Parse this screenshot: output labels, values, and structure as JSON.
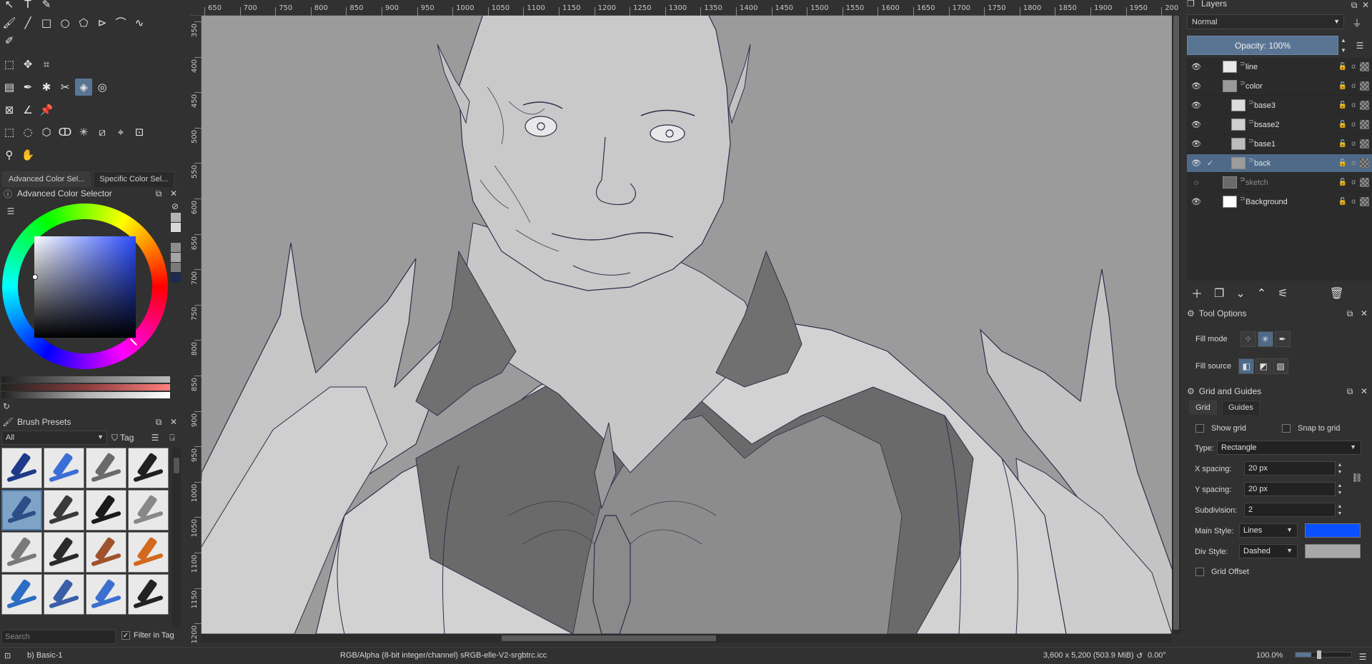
{
  "toolbox": {
    "tools": [
      {
        "name": "select-shapes-tool",
        "glyph": "↖"
      },
      {
        "name": "text-tool",
        "glyph": "T"
      },
      {
        "name": "edit-shapes-tool",
        "glyph": "✎"
      },
      {
        "name": "freehand-brush-tool",
        "glyph": "🖌"
      },
      {
        "name": "line-tool",
        "glyph": "╱"
      },
      {
        "name": "rectangle-tool",
        "glyph": "□"
      },
      {
        "name": "ellipse-tool",
        "glyph": "○"
      },
      {
        "name": "polygon-tool",
        "glyph": "⬠"
      },
      {
        "name": "polyline-tool",
        "glyph": "⊳"
      },
      {
        "name": "bezier-curve-tool",
        "glyph": "⌒"
      },
      {
        "name": "freehand-path-tool",
        "glyph": "∿"
      },
      {
        "name": "dynamic-brush-tool",
        "glyph": "✐"
      },
      {
        "name": "transform-tool",
        "glyph": "⬚"
      },
      {
        "name": "move-tool",
        "glyph": "✥"
      },
      {
        "name": "crop-tool",
        "glyph": "⌗"
      },
      {
        "name": "gradient-tool",
        "glyph": "▤"
      },
      {
        "name": "color-picker-tool",
        "glyph": "✒"
      },
      {
        "name": "colorize-mask-tool",
        "glyph": "✱"
      },
      {
        "name": "smart-patch-tool",
        "glyph": "✂"
      },
      {
        "name": "fill-tool",
        "glyph": "◈"
      },
      {
        "name": "enclose-fill-tool",
        "glyph": "◎"
      },
      {
        "name": "assistant-tool",
        "glyph": "⊠"
      },
      {
        "name": "measure-tool",
        "glyph": "∠"
      },
      {
        "name": "reference-images-tool",
        "glyph": "📌"
      },
      {
        "name": "rectangular-selection-tool",
        "glyph": "⬚"
      },
      {
        "name": "elliptical-selection-tool",
        "glyph": "◌"
      },
      {
        "name": "polygonal-selection-tool",
        "glyph": "⬡"
      },
      {
        "name": "freehand-selection-tool",
        "glyph": "ↀ"
      },
      {
        "name": "contiguous-selection-tool",
        "glyph": "✳"
      },
      {
        "name": "similar-selection-tool",
        "glyph": "⧄"
      },
      {
        "name": "bezier-selection-tool",
        "glyph": "⌖"
      },
      {
        "name": "magnetic-selection-tool",
        "glyph": "⊡"
      },
      {
        "name": "zoom-tool",
        "glyph": "⚲"
      },
      {
        "name": "pan-tool",
        "glyph": "✋"
      }
    ],
    "dock_tabs": [
      "Advanced Color Sel...",
      "Specific Color Sel..."
    ],
    "color_selector_title": "Advanced Color Selector",
    "swatches": [
      "#b3b3b3",
      "#d9d9d9",
      "#313131",
      "#8c8c8c",
      "#a6a6a6",
      "#7a7a7a",
      "#1c2a52"
    ],
    "brush_presets_title": "Brush Presets",
    "brush_filter": "All",
    "tag_label": "Tag",
    "brushes": [
      {
        "name": "brush-eraser-soft",
        "tip": "#1f3a8a"
      },
      {
        "name": "brush-eraser-hard",
        "tip": "#3c6fd6"
      },
      {
        "name": "brush-blender",
        "tip": "#6a6a6a"
      },
      {
        "name": "brush-ink-pen",
        "tip": "#202020"
      },
      {
        "name": "brush-basic-1",
        "tip": "#2b4e86"
      },
      {
        "name": "brush-basic-2",
        "tip": "#3a3a3a"
      },
      {
        "name": "brush-marker",
        "tip": "#1a1a1a"
      },
      {
        "name": "brush-airbrush",
        "tip": "#888888"
      },
      {
        "name": "brush-pencil-soft",
        "tip": "#7a7a7a"
      },
      {
        "name": "brush-ink-brush",
        "tip": "#2a2a2a"
      },
      {
        "name": "brush-paint-brush",
        "tip": "#a0522d"
      },
      {
        "name": "brush-dry-brush",
        "tip": "#d2691e"
      },
      {
        "name": "brush-pencil-blue",
        "tip": "#2b6cc4"
      },
      {
        "name": "brush-pencil-hb",
        "tip": "#3a5ea8"
      },
      {
        "name": "brush-pencil-light",
        "tip": "#3b6fd0"
      },
      {
        "name": "brush-pencil-dark",
        "tip": "#222222"
      }
    ],
    "search_placeholder": "Search",
    "filter_in_tag_label": "Filter in Tag"
  },
  "canvas": {
    "ruler_h": [
      "650",
      "700",
      "750",
      "800",
      "850",
      "900",
      "950",
      "1000",
      "1050",
      "1100",
      "1150",
      "1200",
      "1250",
      "1300",
      "1350",
      "1400",
      "1450",
      "1500",
      "1550",
      "1600",
      "1650",
      "1700",
      "1750",
      "1800",
      "1850",
      "1900",
      "1950",
      "200"
    ],
    "ruler_v": [
      "350",
      "400",
      "450",
      "500",
      "550",
      "600",
      "650",
      "700",
      "750",
      "800",
      "850",
      "900",
      "950",
      "1000",
      "1050",
      "1100",
      "1150",
      "1200"
    ]
  },
  "layers": {
    "title": "Layers",
    "blend_mode": "Normal",
    "opacity_label": "Opacity:  100%",
    "items": [
      {
        "name": "line",
        "visible": true,
        "thumb": "#e8e8e8",
        "indent": 0,
        "selected": false
      },
      {
        "name": "color",
        "visible": true,
        "thumb": "#9a9a9a",
        "indent": 0,
        "selected": false
      },
      {
        "name": "base3",
        "visible": true,
        "thumb": "#dcdcdc",
        "indent": 1,
        "selected": false
      },
      {
        "name": "bsase2",
        "visible": true,
        "thumb": "#cfcfcf",
        "indent": 1,
        "selected": false
      },
      {
        "name": "base1",
        "visible": true,
        "thumb": "#bcbcbc",
        "indent": 1,
        "selected": false
      },
      {
        "name": "back",
        "visible": true,
        "thumb": "#9c9c9c",
        "indent": 1,
        "selected": true
      },
      {
        "name": "sketch",
        "visible": false,
        "thumb": "#6a6a6a",
        "indent": 0,
        "selected": false
      },
      {
        "name": "Background",
        "visible": true,
        "thumb": "#ffffff",
        "indent": 0,
        "selected": false
      }
    ]
  },
  "tool_options": {
    "title": "Tool Options",
    "fill_mode_label": "Fill mode",
    "fill_source_label": "Fill source"
  },
  "grid_guides": {
    "title": "Grid and Guides",
    "tabs": [
      "Grid",
      "Guides"
    ],
    "show_grid_label": "Show grid",
    "snap_to_grid_label": "Snap to grid",
    "type_label": "Type:",
    "type_value": "Rectangle",
    "x_spacing_label": "X spacing:",
    "x_spacing_value": "20 px",
    "y_spacing_label": "Y spacing:",
    "y_spacing_value": "20 px",
    "subdivision_label": "Subdivision:",
    "subdivision_value": "2",
    "main_style_label": "Main Style:",
    "main_style_value": "Lines",
    "main_color": "#0a50ff",
    "div_style_label": "Div Style:",
    "div_style_value": "Dashed",
    "div_color": "#a8a8a8",
    "grid_offset_label": "Grid Offset"
  },
  "status": {
    "brush_name": "b) Basic-1",
    "color_space": "RGB/Alpha (8-bit integer/channel)  sRGB-elle-V2-srgbtrc.icc",
    "image_size": "3,600 x 5,200 (503.9 MiB)",
    "rotation": "0.00°",
    "zoom": "100.0%"
  },
  "colors": {
    "accent": "#5a7594",
    "canvas_bg": "#9a9a9a"
  }
}
